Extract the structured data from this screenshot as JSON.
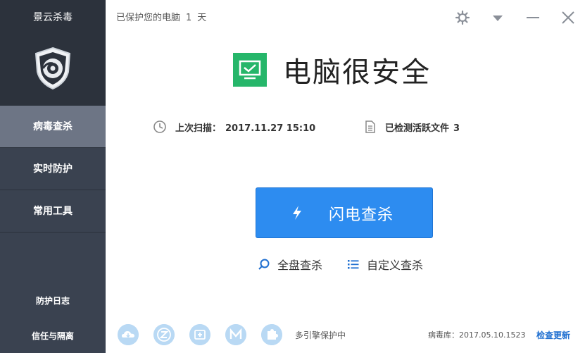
{
  "sidebar": {
    "app_title": "景云杀毒",
    "logo_icon": "shield-logo-icon",
    "nav": [
      {
        "label": "病毒查杀",
        "active": true
      },
      {
        "label": "实时防护",
        "active": false
      },
      {
        "label": "常用工具",
        "active": false
      }
    ],
    "log_label": "防护日志",
    "trust_label": "信任与隔离"
  },
  "header": {
    "status_prefix": "已保护您的电脑",
    "days": "1",
    "days_unit": "天",
    "icons": [
      "gear-icon",
      "dropdown-icon",
      "minimize-icon",
      "close-icon"
    ]
  },
  "main": {
    "status_title": "电脑很安全",
    "last_scan_label": "上次扫描：",
    "last_scan_value": "2017.11.27 15:10",
    "detected_label": "已检测活跃文件",
    "detected_value": "3",
    "quick_scan_label": "闪电查杀",
    "full_scan_label": "全盘查杀",
    "custom_scan_label": "自定义查杀"
  },
  "footer": {
    "engines": [
      "cloud-engine-icon",
      "z-engine-icon",
      "plus-engine-icon",
      "m-engine-icon",
      "puzzle-engine-icon"
    ],
    "engine_status": "多引擎保护中",
    "virus_db_label": "病毒库：",
    "virus_db_value": "2017.05.10.1523",
    "update_label": "检查更新"
  },
  "colors": {
    "sidebar_bg": "#3a4250",
    "sidebar_top_bg": "#2c323c",
    "nav_active_bg": "#6d7585",
    "accent_green": "#26b66a",
    "button_blue": "#2d8cf0",
    "engine_icon_bg": "#b9d9f4"
  }
}
